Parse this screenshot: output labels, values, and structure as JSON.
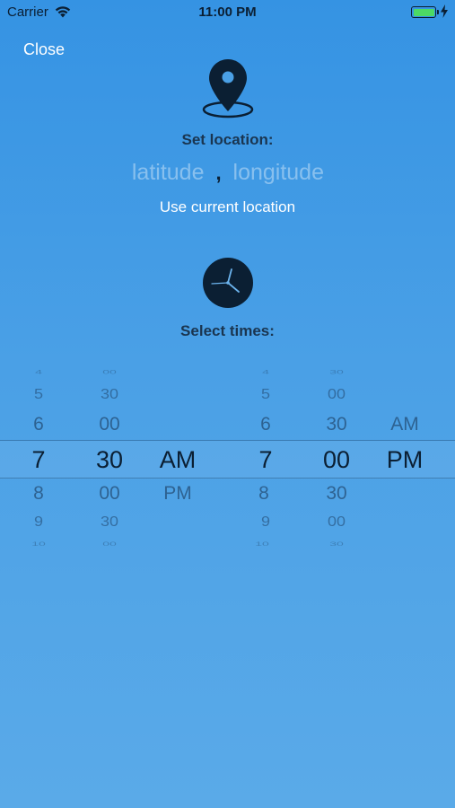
{
  "status_bar": {
    "carrier": "Carrier",
    "time": "11:00 PM"
  },
  "nav": {
    "close_label": "Close"
  },
  "location": {
    "title": "Set location:",
    "latitude_placeholder": "latitude",
    "separator": ",",
    "longitude_placeholder": "longitude",
    "use_current_label": "Use current location"
  },
  "times": {
    "title": "Select times:",
    "start": {
      "hours": [
        "4",
        "5",
        "6",
        "7",
        "8",
        "9",
        "10"
      ],
      "minutes": [
        "00",
        "30",
        "00",
        "30",
        "00",
        "30",
        "00"
      ],
      "period": [
        "AM",
        "PM"
      ],
      "selected": {
        "hour": "7",
        "minute": "30",
        "period": "AM"
      }
    },
    "end": {
      "hours": [
        "4",
        "5",
        "6",
        "7",
        "8",
        "9",
        "10"
      ],
      "minutes": [
        "30",
        "00",
        "30",
        "00",
        "30",
        "00",
        "30"
      ],
      "period": [
        "AM",
        "PM"
      ],
      "selected": {
        "hour": "7",
        "minute": "00",
        "period": "PM"
      }
    }
  },
  "colors": {
    "accent_text": "#ffffff",
    "dark": "#0b1f33",
    "battery": "#4cd964"
  }
}
